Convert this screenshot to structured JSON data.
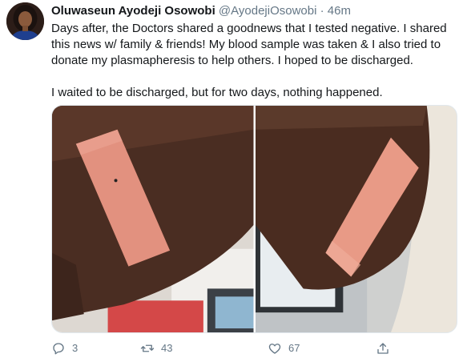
{
  "tweet": {
    "author_name": "Oluwaseun Ayodeji Osowobi",
    "author_handle": "@AyodejiOsowobi",
    "separator": "·",
    "time": "46m",
    "paragraph_1": "Days after, the Doctors shared a goodnews that I tested negative. I shared this news w/ family & friends! My blood sample was taken & I also tried to donate my plasmapheresis to help others. I hoped to be discharged.",
    "paragraph_2": "I waited to be discharged, but for two days, nothing happened."
  },
  "actions": {
    "reply_count": "3",
    "retweet_count": "43",
    "like_count": "67"
  },
  "icons": {
    "reply": "reply-icon",
    "retweet": "retweet-icon",
    "like": "heart-icon",
    "share": "share-icon"
  },
  "colors": {
    "text_primary": "#14171a",
    "text_secondary": "#657786",
    "border": "#e1e8ed"
  }
}
